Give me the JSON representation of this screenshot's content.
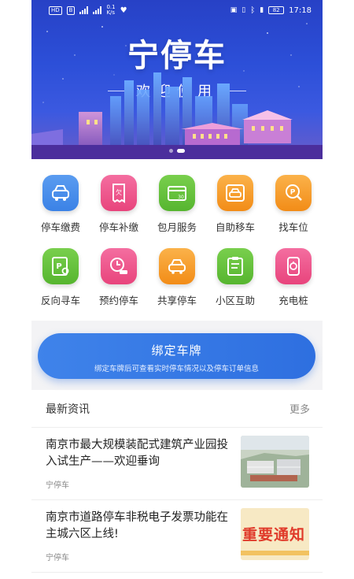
{
  "status_bar": {
    "left_icons": [
      "HD",
      "B"
    ],
    "network_speed": "0.1\nK/s",
    "time": "17:18",
    "battery": "82"
  },
  "banner": {
    "title": "宁停车",
    "subtitle": "欢迎使用",
    "page_indicator": {
      "count": 2,
      "active": 1
    }
  },
  "grid": {
    "items": [
      {
        "label": "停车缴费",
        "icon": "car-front-icon",
        "color": "#3b82e6"
      },
      {
        "label": "停车补缴",
        "icon": "receipt-icon",
        "color": "#ec4f86"
      },
      {
        "label": "包月服务",
        "icon": "monthly-card-icon",
        "color": "#5fbf3a"
      },
      {
        "label": "自助移车",
        "icon": "move-car-icon",
        "color": "#f59a23"
      },
      {
        "label": "找车位",
        "icon": "parking-search-icon",
        "color": "#f59a23"
      },
      {
        "label": "反向寻车",
        "icon": "reverse-find-icon",
        "color": "#5fbf3a"
      },
      {
        "label": "预约停车",
        "icon": "reserve-clock-icon",
        "color": "#ec4f86"
      },
      {
        "label": "共享停车",
        "icon": "shared-parking-icon",
        "color": "#f59a23"
      },
      {
        "label": "小区互助",
        "icon": "community-clipboard-icon",
        "color": "#5fbf3a"
      },
      {
        "label": "充电桩",
        "icon": "charging-pile-icon",
        "color": "#ec4f86"
      }
    ]
  },
  "bind_plate": {
    "title": "绑定车牌",
    "subtitle": "绑定车牌后可查看实时停车情况以及停车订单信息"
  },
  "news": {
    "header": "最新资讯",
    "more": "更多",
    "items": [
      {
        "title": "南京市最大规模装配式建筑产业园投入试生产——欢迎垂询",
        "source": "宁停车"
      },
      {
        "title": "南京市道路停车非税电子发票功能在主城六区上线!",
        "source": "宁停车",
        "thumb_text": "重要通知"
      }
    ]
  }
}
